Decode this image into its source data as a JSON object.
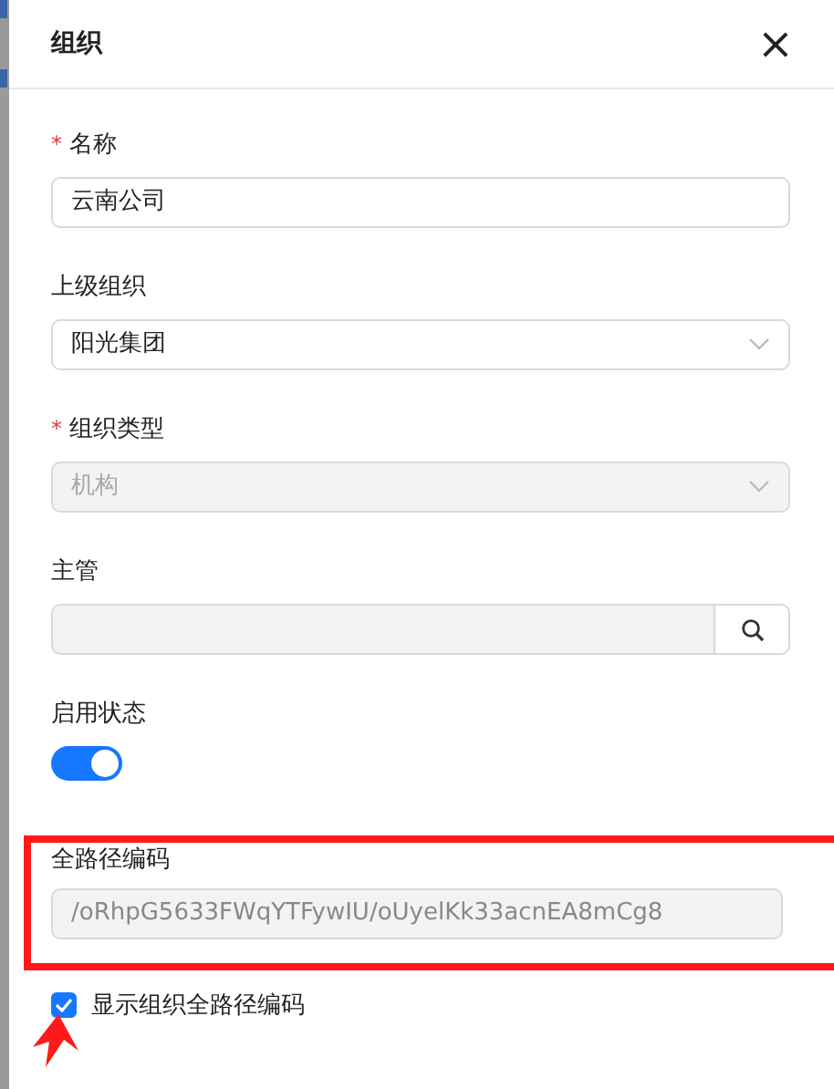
{
  "dialog": {
    "title": "组织",
    "close": "×"
  },
  "fields": [
    {
      "kind": "text",
      "required_mark": "*",
      "label": "名称",
      "value": "云南公司"
    },
    {
      "kind": "select",
      "label": "上级组织",
      "value": "阳光集团"
    },
    {
      "kind": "select",
      "required_mark": "*",
      "label": "组织类型",
      "value": "机构",
      "disabled": true
    },
    {
      "kind": "search",
      "label": "主管",
      "disabled": true
    },
    {
      "kind": "switch",
      "label": "启用状态",
      "on": true
    },
    {
      "kind": "text",
      "label": "全路径编码",
      "value": "/oRhpG5633FWqYTFywIU/oUyelKk33acnEA8mCg8",
      "disabled": true,
      "highlighted": true
    }
  ],
  "checkbox": {
    "label": "显示组织全路径编码",
    "checked": true,
    "pointed": true
  }
}
